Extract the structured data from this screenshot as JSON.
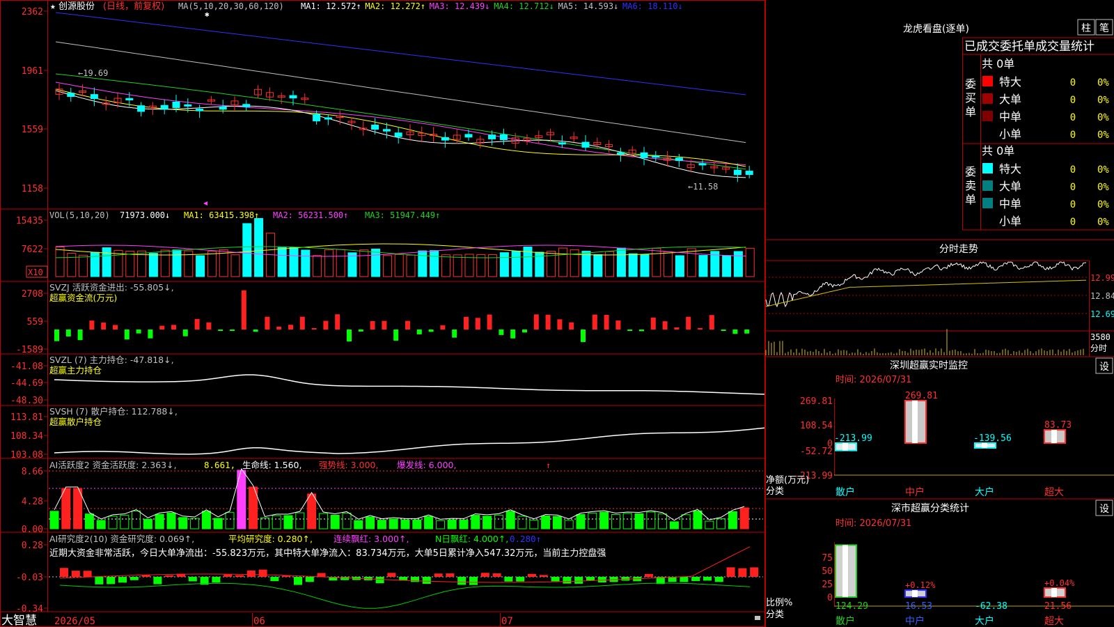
{
  "kline": {
    "star": "★",
    "stock_name": "创源股份",
    "mode": "(日线，前复权)",
    "ma_params": "MA(5,10,20,30,60,120)",
    "ma_items": [
      {
        "label": "MA1:",
        "value": "12.572↑",
        "color": "#ffffff"
      },
      {
        "label": "MA2:",
        "value": "12.272↑",
        "color": "#ffff00"
      },
      {
        "label": "MA3:",
        "value": "12.439↓",
        "color": "#ff40ff"
      },
      {
        "label": "MA4:",
        "value": "12.712↓",
        "color": "#20d020"
      },
      {
        "label": "MA5:",
        "value": "14.593↓",
        "color": "#c0c0c0"
      },
      {
        "label": "MA6:",
        "value": "18.110↓",
        "color": "#3030ff"
      }
    ],
    "y_ticks": [
      "2362",
      "1961",
      "1559",
      "1158"
    ],
    "high_mark": "←19.69",
    "low_mark": "←11.58"
  },
  "vol": {
    "params": "VOL(5,10,20)",
    "value": "71973.000↓",
    "ma1": "MA1: 63415.398↑",
    "ma2": "MA2: 56231.500↑",
    "ma3": "MA3: 51947.449↑",
    "y_ticks": [
      "15435",
      "7622"
    ],
    "unit": "X10"
  },
  "svzj": {
    "title": "SVZJ  活跃资金进出: -55.805↓,",
    "subtitle": "超赢资金流(万元)",
    "y_ticks": [
      "2708",
      "559",
      "-1589"
    ]
  },
  "svzl": {
    "title": "SVZL (7) 主力持仓: -47.818↓,",
    "subtitle": "超赢主力持仓",
    "y_ticks": [
      "-41.08",
      "-44.69",
      "-48.30"
    ]
  },
  "svsh": {
    "title": "SVSH (7) 散户持仓: 112.788↓,",
    "subtitle": "超赢散户持仓",
    "y_ticks": [
      "113.81",
      "108.34",
      "103.08"
    ]
  },
  "ai2": {
    "title": "AI活跃度2 资金活跃度: 2.363↓,",
    "v2": "8.661,",
    "life": "生命线: 1.560,",
    "strong": "强势线: 3.000,",
    "burst": "爆发线: 6.000,",
    "y_ticks": [
      "8.66",
      "4.28",
      "0.00"
    ]
  },
  "research": {
    "title": "AI研究度2(10) 资金研究度: 0.069↑,",
    "avg": "平均研究度: 0.280↑,",
    "cont": "连续飘红: 3.000↑,",
    "nday": "N日飘红: 4.000↑,",
    "last": "0.280↑",
    "summary": "近期大资金非常活跃，今日大单净流出：-55.823万元，其中特大单净流入：83.734万元，大单5日累计净入547.32万元，当前主力控盘强",
    "y_ticks": [
      "0.28",
      "-0.03",
      "-0.34"
    ]
  },
  "bottom": {
    "brand": "大智慧",
    "dates": [
      "2026/05",
      "06",
      "07"
    ]
  },
  "lhb": {
    "title": "龙虎看盘(逐单)",
    "btn_zhu": "柱",
    "btn_bi": "笔",
    "heading": "已成交委托单成交量统计",
    "buy_label": "委买单",
    "sell_label": "委卖单",
    "buy_total": "共 0单",
    "sell_total": "共 0单",
    "buy_rows": [
      {
        "name": "特大",
        "count": "0",
        "pct": "0%",
        "color": "#ff0000"
      },
      {
        "name": "大单",
        "count": "0",
        "pct": "0%",
        "color": "#a00000"
      },
      {
        "name": "中单",
        "count": "0",
        "pct": "0%",
        "color": "#800000"
      },
      {
        "name": "小单",
        "count": "0",
        "pct": "0%",
        "color": ""
      }
    ],
    "sell_rows": [
      {
        "name": "特大",
        "count": "0",
        "pct": "0%",
        "color": "#00ffff"
      },
      {
        "name": "大单",
        "count": "0",
        "pct": "0%",
        "color": "#008080"
      },
      {
        "name": "中单",
        "count": "0",
        "pct": "0%",
        "color": "#008080"
      },
      {
        "name": "小单",
        "count": "0",
        "pct": "0%",
        "color": ""
      }
    ]
  },
  "fenshi": {
    "title": "分时走势",
    "y_ticks": [
      "12.99",
      "12.84",
      "12.69"
    ],
    "vol_tick": "3580",
    "vol_label": "分时"
  },
  "sz_monitor": {
    "title": "深圳超赢实时监控",
    "btn": "设",
    "time": "时间: 2026/07/31",
    "y_ticks": [
      "269.81",
      "108.54",
      "0",
      "-52.72",
      "-213.99"
    ],
    "y_label": "净额(万元)",
    "x_label": "分类",
    "categories": [
      "散户",
      "中户",
      "大户",
      "超大"
    ],
    "values": [
      -213.99,
      269.81,
      -139.56,
      83.73
    ],
    "value_labels": [
      "-213.99",
      "269.81",
      "-139.56",
      "83.73"
    ]
  },
  "sz_class": {
    "title": "深市超赢分类统计",
    "btn": "设",
    "time": "时间: 2026/07/31",
    "y_ticks": [
      "75",
      "50",
      "25",
      "0"
    ],
    "y_label": "比例%",
    "x_label": "分类",
    "categories": [
      "散户",
      "中户",
      "大户",
      "超大"
    ],
    "values": [
      124.29,
      16.53,
      -62.38,
      21.56
    ],
    "value_labels": [
      "124.29",
      "16.53",
      "-62.38",
      "21.56"
    ],
    "pct_labels": [
      "",
      "+0.12%",
      "",
      "+0.04%"
    ]
  }
}
